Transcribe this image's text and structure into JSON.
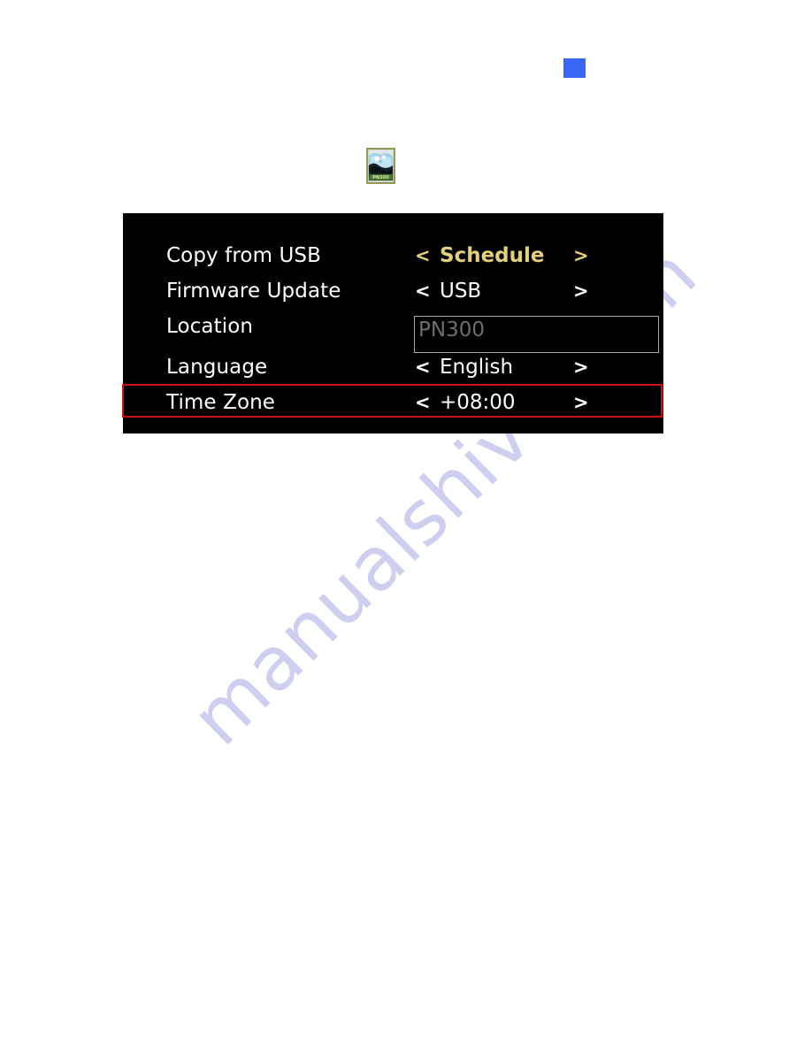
{
  "page": {
    "background_color": "#ffffff",
    "watermark_text": "manualshive.com",
    "watermark_color": "#ccccf0"
  },
  "decorations": {
    "blue_square": {
      "name": "blue-square-marker",
      "color": "#3a66f5"
    },
    "thumbnail": {
      "name": "product-thumbnail",
      "border_color": "#9a9a5e"
    }
  },
  "osd": {
    "panel_background": "#000000",
    "accent_color": "#e3cf7c",
    "selection_color": "#c81414",
    "rows": [
      {
        "label": "Copy from USB",
        "type": "stepper",
        "value": "Schedule",
        "left_arrow": "<",
        "right_arrow": ">",
        "accent": true
      },
      {
        "label": "Firmware Update",
        "type": "stepper",
        "value": "USB",
        "left_arrow": "<",
        "right_arrow": ">",
        "accent": false
      },
      {
        "label": "Location",
        "type": "text",
        "value": "PN300",
        "accent": false
      },
      {
        "label": "Language",
        "type": "stepper",
        "value": "English",
        "left_arrow": "<",
        "right_arrow": ">",
        "accent": false
      },
      {
        "label": "Time Zone",
        "type": "stepper",
        "value": "+08:00",
        "left_arrow": "<",
        "right_arrow": ">",
        "accent": false,
        "selected": true
      }
    ]
  }
}
